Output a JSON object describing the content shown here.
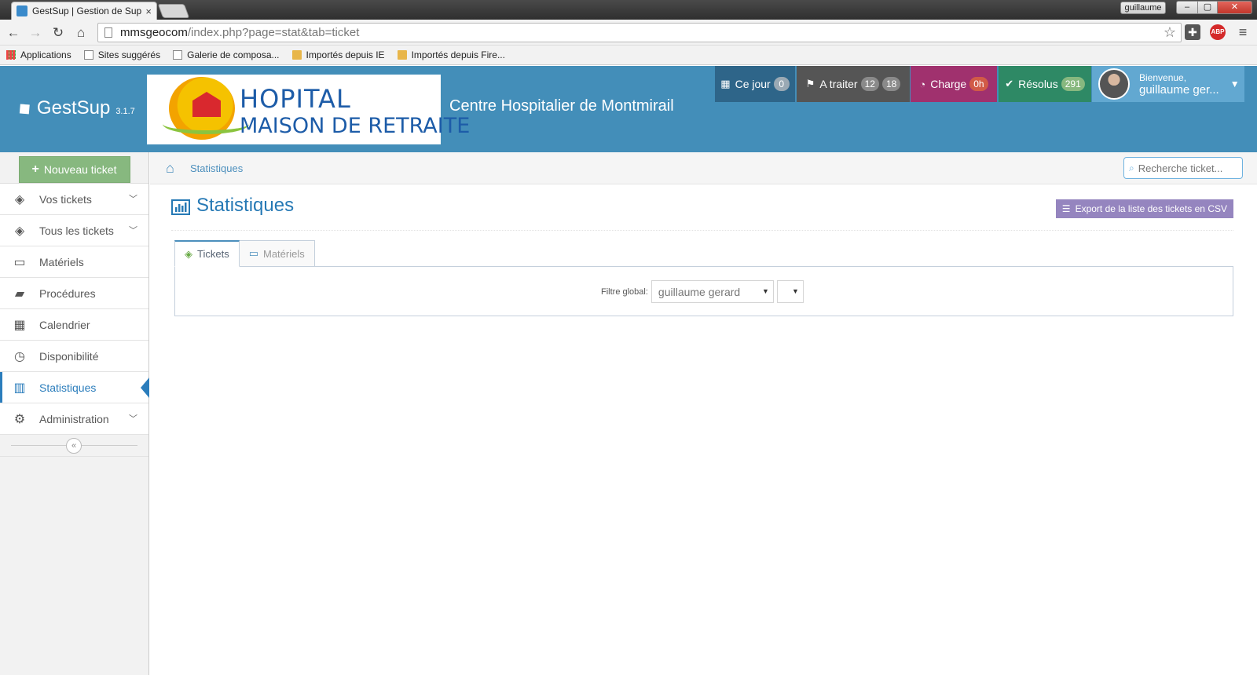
{
  "browser": {
    "tab_title": "GestSup | Gestion de Supp",
    "tab_close": "×",
    "user_chip": "guillaume",
    "win_min": "–",
    "win_max": "▢",
    "win_close": "✕",
    "url_host": "mmsgeocom",
    "url_path": "/index.php?page=stat&tab=ticket",
    "back": "←",
    "forward": "→",
    "reload": "↻",
    "home": "⌂",
    "star": "☆",
    "ext_abp": "ABP",
    "menu": "≡",
    "bookmarks": [
      "Applications",
      "Sites suggérés",
      "Galerie de composa...",
      "Importés depuis IE",
      "Importés depuis Fire..."
    ]
  },
  "header": {
    "brand_name": "GestSup",
    "brand_version": "3.1.7",
    "logo_line1": "HOPITAL",
    "logo_line2": "MAISON DE RETRAITE",
    "site_title": "Centre Hospitalier de Montmirail",
    "today_label": "Ce jour",
    "today_count": "0",
    "treat_label": "A traiter",
    "treat_count_1": "12",
    "treat_count_2": "18",
    "charge_label": "Charge",
    "charge_value": "0h",
    "solved_label": "Résolus",
    "solved_count": "291",
    "welcome": "Bienvenue,",
    "user_name": "guillaume ger...",
    "caret": "▼"
  },
  "sidebar": {
    "new_ticket": "Nouveau ticket",
    "items": [
      {
        "label": "Vos tickets"
      },
      {
        "label": "Tous les tickets"
      },
      {
        "label": "Matériels"
      },
      {
        "label": "Procédures"
      },
      {
        "label": "Calendrier"
      },
      {
        "label": "Disponibilité"
      },
      {
        "label": "Statistiques"
      },
      {
        "label": "Administration"
      }
    ],
    "collapse": "«"
  },
  "main": {
    "breadcrumb": "Statistiques",
    "search_placeholder": "Recherche ticket...",
    "page_title": "Statistiques",
    "export_label": "Export de la liste des tickets en CSV",
    "tabs": [
      {
        "label": "Tickets"
      },
      {
        "label": "Matériels"
      }
    ],
    "filter_label": "Filtre global:",
    "filter_value": "guillaume gerard",
    "filter_extra": ""
  },
  "colors": {
    "header_bg": "#438eb9",
    "today": "#2e6589",
    "treat": "#555555",
    "charge": "#a0316e",
    "solved": "#2e8965",
    "user": "#62a8d1",
    "new_ticket": "#87b87f",
    "export": "#9585bf",
    "active": "#2b7dbc"
  }
}
